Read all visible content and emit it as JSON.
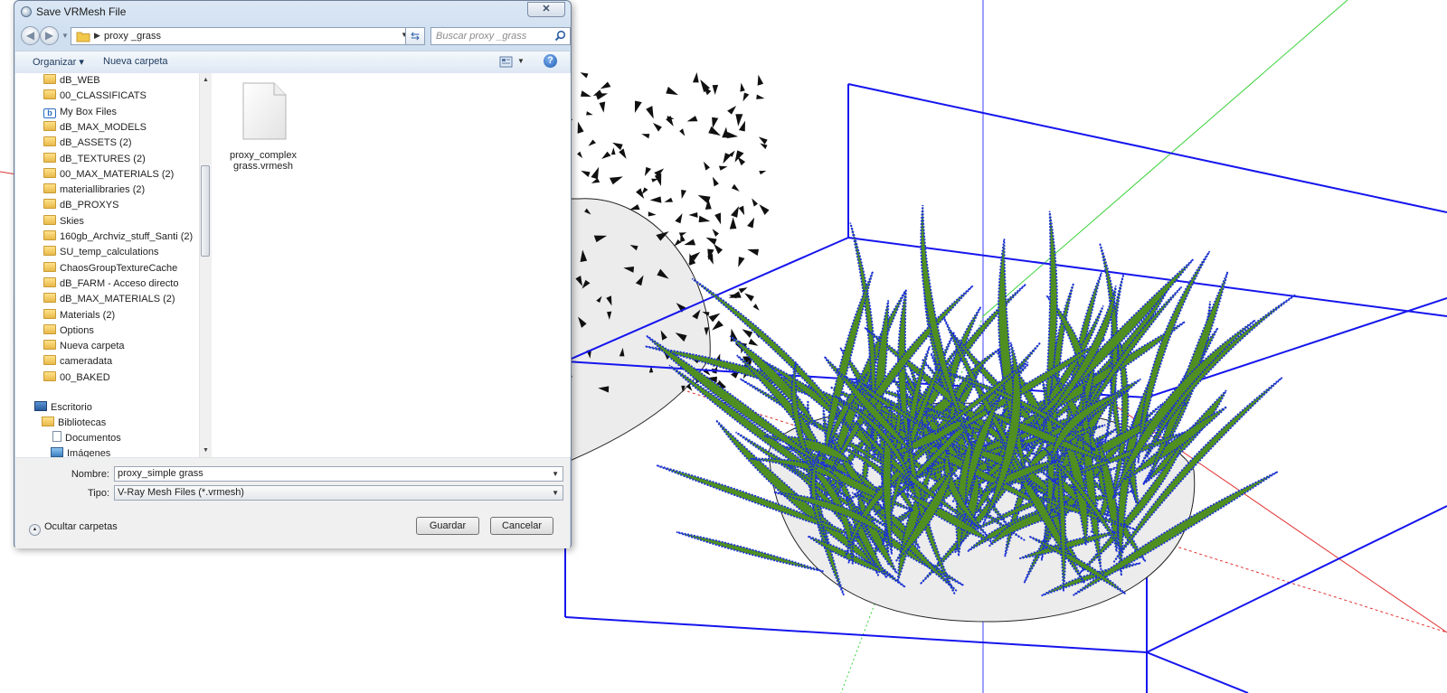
{
  "dialog": {
    "title": "Save VRMesh File",
    "close_glyph": "✕",
    "address": {
      "path": "proxy _grass"
    },
    "search": {
      "placeholder": "Buscar proxy _grass"
    },
    "toolbar": {
      "organize": "Organizar ▾",
      "new_folder": "Nueva carpeta"
    },
    "nav_items": [
      {
        "label": "dB_WEB",
        "icon": "folder-icon"
      },
      {
        "label": "00_CLASSIFICATS",
        "icon": "folder-icon"
      },
      {
        "label": "My Box Files",
        "icon": "box-icon"
      },
      {
        "label": "dB_MAX_MODELS",
        "icon": "folder-icon"
      },
      {
        "label": "dB_ASSETS (2)",
        "icon": "folder-icon"
      },
      {
        "label": "dB_TEXTURES (2)",
        "icon": "folder-icon"
      },
      {
        "label": "00_MAX_MATERIALS (2)",
        "icon": "folder-icon"
      },
      {
        "label": "materiallibraries (2)",
        "icon": "folder-icon"
      },
      {
        "label": "dB_PROXYS",
        "icon": "folder-icon"
      },
      {
        "label": "Skies",
        "icon": "folder-icon"
      },
      {
        "label": "160gb_Archviz_stuff_Santi (2)",
        "icon": "folder-icon"
      },
      {
        "label": "SU_temp_calculations",
        "icon": "folder-icon"
      },
      {
        "label": "ChaosGroupTextureCache",
        "icon": "folder-icon"
      },
      {
        "label": "dB_FARM - Acceso directo",
        "icon": "folder-icon"
      },
      {
        "label": "dB_MAX_MATERIALS (2)",
        "icon": "folder-icon"
      },
      {
        "label": "Materials (2)",
        "icon": "folder-icon"
      },
      {
        "label": "Options",
        "icon": "folder-icon"
      },
      {
        "label": "Nueva carpeta",
        "icon": "folder-icon"
      },
      {
        "label": "cameradata",
        "icon": "folder-icon"
      },
      {
        "label": "00_BAKED",
        "icon": "folder-icon"
      }
    ],
    "nav_tree": [
      {
        "label": "Escritorio",
        "icon": "desktop-icon"
      },
      {
        "label": "Bibliotecas",
        "icon": "library-icon"
      },
      {
        "label": "Documentos",
        "icon": "document-icon"
      },
      {
        "label": "Imágenes",
        "icon": "image-icon"
      }
    ],
    "files": [
      {
        "name_line1": "proxy_complex",
        "name_line2": "grass.vrmesh"
      }
    ],
    "filename_label": "Nombre:",
    "filename_value": "proxy_simple grass",
    "type_label": "Tipo:",
    "type_value": "V-Ray Mesh Files (*.vrmesh)",
    "hide_folders": "Ocultar carpetas",
    "save_button": "Guardar",
    "cancel_button": "Cancelar"
  },
  "colors": {
    "bounding_box": "#1515ee",
    "grass_fill": "#4f8f22",
    "grass_outline": "#1a2fd8",
    "axis_green": "#39d239",
    "axis_red": "#e23232"
  }
}
